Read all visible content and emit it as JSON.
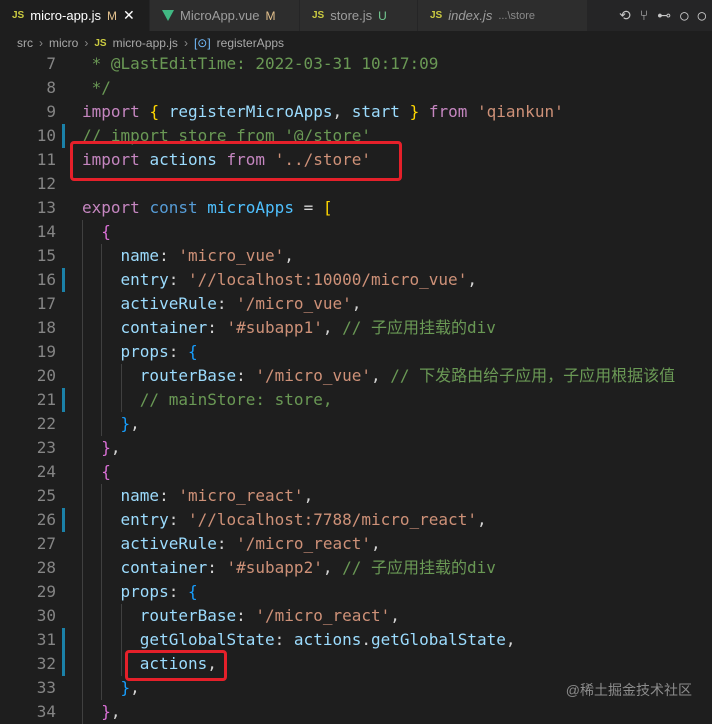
{
  "tabs": [
    {
      "icon": "JS",
      "name": "micro-app.js",
      "status": "M",
      "active": true
    },
    {
      "icon": "vue",
      "name": "MicroApp.vue",
      "status": "M",
      "active": false
    },
    {
      "icon": "JS",
      "name": "store.js",
      "status": "U",
      "active": false
    },
    {
      "icon": "JS",
      "name": "index.js",
      "desc": "...\\store",
      "active": false
    }
  ],
  "breadcrumb": {
    "items": [
      "src",
      "micro",
      "micro-app.js",
      "registerApps"
    ]
  },
  "code_lines": [
    {
      "n": "7",
      "parts": [
        [
          "cm",
          " * @LastEditTime: 2022-03-31 10:17:09"
        ]
      ]
    },
    {
      "n": "8",
      "parts": [
        [
          "cm",
          " */"
        ]
      ]
    },
    {
      "n": "9",
      "parts": [
        [
          "kw",
          "import"
        ],
        [
          "pn",
          " "
        ],
        [
          "br1",
          "{"
        ],
        [
          "pn",
          " "
        ],
        [
          "var",
          "registerMicroApps"
        ],
        [
          "pn",
          ", "
        ],
        [
          "var",
          "start"
        ],
        [
          "pn",
          " "
        ],
        [
          "br1",
          "}"
        ],
        [
          "pn",
          " "
        ],
        [
          "kw",
          "from"
        ],
        [
          "pn",
          " "
        ],
        [
          "str",
          "'qiankun'"
        ]
      ]
    },
    {
      "n": "10",
      "mod": true,
      "parts": [
        [
          "cm",
          "// import store from '@/store'"
        ]
      ]
    },
    {
      "n": "11",
      "parts": [
        [
          "kw",
          "import"
        ],
        [
          "pn",
          " "
        ],
        [
          "var",
          "actions"
        ],
        [
          "pn",
          " "
        ],
        [
          "kw",
          "from"
        ],
        [
          "pn",
          " "
        ],
        [
          "str",
          "'../store'"
        ]
      ]
    },
    {
      "n": "12",
      "parts": []
    },
    {
      "n": "13",
      "parts": [
        [
          "kw",
          "export"
        ],
        [
          "pn",
          " "
        ],
        [
          "kwb",
          "const"
        ],
        [
          "pn",
          " "
        ],
        [
          "cnst",
          "microApps"
        ],
        [
          "pn",
          " = "
        ],
        [
          "br1",
          "["
        ]
      ]
    },
    {
      "n": "14",
      "parts": [
        [
          "pn",
          "  "
        ],
        [
          "br2",
          "{"
        ]
      ]
    },
    {
      "n": "15",
      "parts": [
        [
          "pn",
          "    "
        ],
        [
          "var",
          "name"
        ],
        [
          "pn",
          ": "
        ],
        [
          "str",
          "'micro_vue'"
        ],
        [
          "pn",
          ","
        ]
      ]
    },
    {
      "n": "16",
      "mod": true,
      "parts": [
        [
          "pn",
          "    "
        ],
        [
          "var",
          "entry"
        ],
        [
          "pn",
          ": "
        ],
        [
          "str",
          "'//localhost:10000/micro_vue'"
        ],
        [
          "pn",
          ","
        ]
      ]
    },
    {
      "n": "17",
      "parts": [
        [
          "pn",
          "    "
        ],
        [
          "var",
          "activeRule"
        ],
        [
          "pn",
          ": "
        ],
        [
          "str",
          "'/micro_vue'"
        ],
        [
          "pn",
          ","
        ]
      ]
    },
    {
      "n": "18",
      "parts": [
        [
          "pn",
          "    "
        ],
        [
          "var",
          "container"
        ],
        [
          "pn",
          ": "
        ],
        [
          "str",
          "'#subapp1'"
        ],
        [
          "pn",
          ", "
        ],
        [
          "cm",
          "// 子应用挂载的div"
        ]
      ]
    },
    {
      "n": "19",
      "parts": [
        [
          "pn",
          "    "
        ],
        [
          "var",
          "props"
        ],
        [
          "pn",
          ": "
        ],
        [
          "br3",
          "{"
        ]
      ]
    },
    {
      "n": "20",
      "parts": [
        [
          "pn",
          "      "
        ],
        [
          "var",
          "routerBase"
        ],
        [
          "pn",
          ": "
        ],
        [
          "str",
          "'/micro_vue'"
        ],
        [
          "pn",
          ", "
        ],
        [
          "cm",
          "// 下发路由给子应用，子应用根据该值"
        ]
      ]
    },
    {
      "n": "21",
      "mod": true,
      "parts": [
        [
          "pn",
          "      "
        ],
        [
          "cm",
          "// mainStore: store,"
        ]
      ]
    },
    {
      "n": "22",
      "parts": [
        [
          "pn",
          "    "
        ],
        [
          "br3",
          "}"
        ],
        [
          "pn",
          ","
        ]
      ]
    },
    {
      "n": "23",
      "parts": [
        [
          "pn",
          "  "
        ],
        [
          "br2",
          "}"
        ],
        [
          "pn",
          ","
        ]
      ]
    },
    {
      "n": "24",
      "parts": [
        [
          "pn",
          "  "
        ],
        [
          "br2",
          "{"
        ]
      ]
    },
    {
      "n": "25",
      "parts": [
        [
          "pn",
          "    "
        ],
        [
          "var",
          "name"
        ],
        [
          "pn",
          ": "
        ],
        [
          "str",
          "'micro_react'"
        ],
        [
          "pn",
          ","
        ]
      ]
    },
    {
      "n": "26",
      "mod": true,
      "parts": [
        [
          "pn",
          "    "
        ],
        [
          "var",
          "entry"
        ],
        [
          "pn",
          ": "
        ],
        [
          "str",
          "'//localhost:7788/micro_react'"
        ],
        [
          "pn",
          ","
        ]
      ]
    },
    {
      "n": "27",
      "parts": [
        [
          "pn",
          "    "
        ],
        [
          "var",
          "activeRule"
        ],
        [
          "pn",
          ": "
        ],
        [
          "str",
          "'/micro_react'"
        ],
        [
          "pn",
          ","
        ]
      ]
    },
    {
      "n": "28",
      "parts": [
        [
          "pn",
          "    "
        ],
        [
          "var",
          "container"
        ],
        [
          "pn",
          ": "
        ],
        [
          "str",
          "'#subapp2'"
        ],
        [
          "pn",
          ", "
        ],
        [
          "cm",
          "// 子应用挂载的div"
        ]
      ]
    },
    {
      "n": "29",
      "parts": [
        [
          "pn",
          "    "
        ],
        [
          "var",
          "props"
        ],
        [
          "pn",
          ": "
        ],
        [
          "br3",
          "{"
        ]
      ]
    },
    {
      "n": "30",
      "parts": [
        [
          "pn",
          "      "
        ],
        [
          "var",
          "routerBase"
        ],
        [
          "pn",
          ": "
        ],
        [
          "str",
          "'/micro_react'"
        ],
        [
          "pn",
          ","
        ]
      ]
    },
    {
      "n": "31",
      "mod": true,
      "parts": [
        [
          "pn",
          "      "
        ],
        [
          "var",
          "getGlobalState"
        ],
        [
          "pn",
          ": "
        ],
        [
          "var",
          "actions"
        ],
        [
          "pn",
          "."
        ],
        [
          "var",
          "getGlobalState"
        ],
        [
          "pn",
          ","
        ]
      ]
    },
    {
      "n": "32",
      "mod": true,
      "parts": [
        [
          "pn",
          "      "
        ],
        [
          "var",
          "actions"
        ],
        [
          "pn",
          ","
        ]
      ]
    },
    {
      "n": "33",
      "parts": [
        [
          "pn",
          "    "
        ],
        [
          "br3",
          "}"
        ],
        [
          "pn",
          ","
        ]
      ]
    },
    {
      "n": "34",
      "parts": [
        [
          "pn",
          "  "
        ],
        [
          "br2",
          "}"
        ],
        [
          "pn",
          ","
        ]
      ]
    }
  ],
  "watermark": "@稀土掘金技术社区",
  "colors": {
    "highlight": "#e5202a",
    "editor_bg": "#1e1e1e",
    "modified_gutter": "#1b81a8"
  }
}
